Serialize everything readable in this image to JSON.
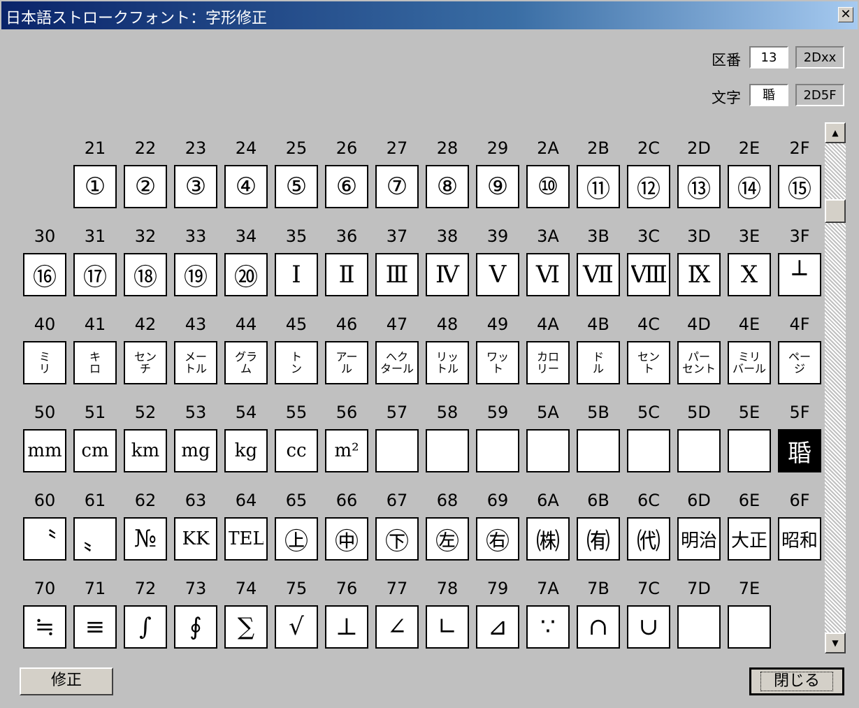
{
  "window": {
    "title": "日本語ストロークフォント：字形修正",
    "close_glyph": "✕"
  },
  "fields": {
    "ku_label": "区番",
    "ku_value": "13",
    "ku_code": "2Dxx",
    "char_label": "文字",
    "char_value": "䎽",
    "char_code": "2D5F"
  },
  "rows": [
    {
      "row": "2",
      "headers": [
        "",
        "21",
        "22",
        "23",
        "24",
        "25",
        "26",
        "27",
        "28",
        "29",
        "2A",
        "2B",
        "2C",
        "2D",
        "2E",
        "2F"
      ],
      "cells": [
        "",
        "①",
        "②",
        "③",
        "④",
        "⑤",
        "⑥",
        "⑦",
        "⑧",
        "⑨",
        "⑩",
        "⑪",
        "⑫",
        "⑬",
        "⑭",
        "⑮"
      ]
    },
    {
      "row": "3",
      "headers": [
        "30",
        "31",
        "32",
        "33",
        "34",
        "35",
        "36",
        "37",
        "38",
        "39",
        "3A",
        "3B",
        "3C",
        "3D",
        "3E",
        "3F"
      ],
      "cells": [
        "⑯",
        "⑰",
        "⑱",
        "⑲",
        "⑳",
        "Ⅰ",
        "Ⅱ",
        "Ⅲ",
        "Ⅳ",
        "Ⅴ",
        "Ⅵ",
        "Ⅶ",
        "Ⅷ",
        "Ⅸ",
        "Ⅹ",
        "┴"
      ]
    },
    {
      "row": "4",
      "headers": [
        "40",
        "41",
        "42",
        "43",
        "44",
        "45",
        "46",
        "47",
        "48",
        "49",
        "4A",
        "4B",
        "4C",
        "4D",
        "4E",
        "4F"
      ],
      "cells": [
        "ミ\nリ",
        "キ\nロ",
        "セン\nチ",
        "メー\nトル",
        "グラ\nム",
        "ト\nン",
        "アー\nル",
        "ヘク\nタール",
        "リッ\nトル",
        "ワッ\nト",
        "カロ\nリー",
        "ド\nル",
        "セン\nト",
        "パー\nセント",
        "ミリ\nバール",
        "ペー\nジ"
      ]
    },
    {
      "row": "5",
      "headers": [
        "50",
        "51",
        "52",
        "53",
        "54",
        "55",
        "56",
        "57",
        "58",
        "59",
        "5A",
        "5B",
        "5C",
        "5D",
        "5E",
        "5F"
      ],
      "cells": [
        "mm",
        "cm",
        "km",
        "mg",
        "kg",
        "cc",
        "m²",
        "",
        "",
        "",
        "",
        "",
        "",
        "",
        "",
        "䎽"
      ]
    },
    {
      "row": "6",
      "headers": [
        "60",
        "61",
        "62",
        "63",
        "64",
        "65",
        "66",
        "67",
        "68",
        "69",
        "6A",
        "6B",
        "6C",
        "6D",
        "6E",
        "6F"
      ],
      "cells": [
        "〝",
        "〟",
        "№",
        "KK",
        "TEL",
        "㊤",
        "㊥",
        "㊦",
        "㊧",
        "㊨",
        "㈱",
        "㈲",
        "㈹",
        "明治",
        "大正",
        "昭和"
      ]
    },
    {
      "row": "7",
      "headers": [
        "70",
        "71",
        "72",
        "73",
        "74",
        "75",
        "76",
        "77",
        "78",
        "79",
        "7A",
        "7B",
        "7C",
        "7D",
        "7E",
        ""
      ],
      "cells": [
        "≒",
        "≡",
        "∫",
        "∮",
        "∑",
        "√",
        "⊥",
        "∠",
        "∟",
        "⊿",
        "∵",
        "∩",
        "∪",
        "",
        "",
        ""
      ]
    }
  ],
  "selected": "5F",
  "buttons": {
    "modify": "修正",
    "close": "閉じる"
  },
  "scrollbar": {
    "up": "▲",
    "down": "▼"
  }
}
